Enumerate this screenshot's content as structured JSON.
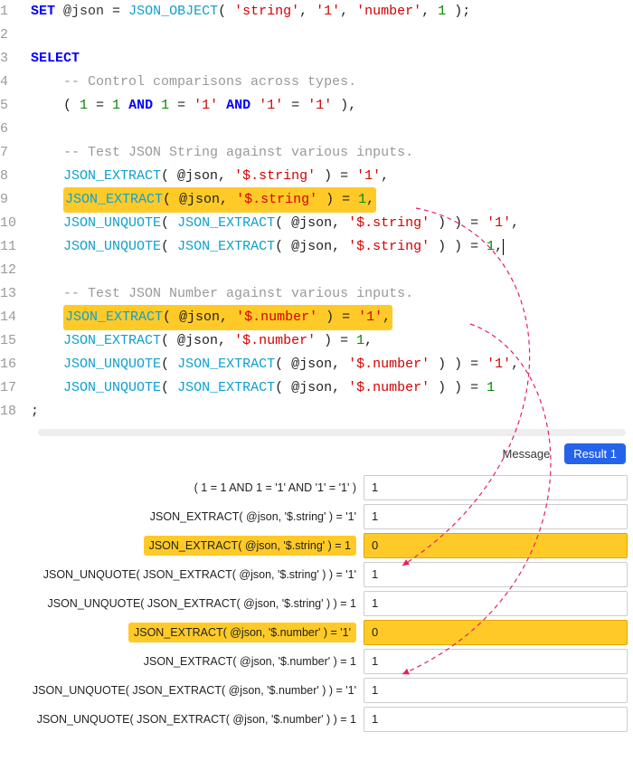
{
  "editor": {
    "lines": [
      {
        "n": 1,
        "tokens": [
          {
            "t": "SET",
            "c": "kw"
          },
          {
            "t": " ",
            "c": "txt"
          },
          {
            "t": "@json",
            "c": "var"
          },
          {
            "t": " = ",
            "c": "txt"
          },
          {
            "t": "JSON_OBJECT",
            "c": "fn"
          },
          {
            "t": "( ",
            "c": "txt"
          },
          {
            "t": "'string'",
            "c": "str"
          },
          {
            "t": ", ",
            "c": "txt"
          },
          {
            "t": "'1'",
            "c": "str"
          },
          {
            "t": ", ",
            "c": "txt"
          },
          {
            "t": "'number'",
            "c": "str"
          },
          {
            "t": ", ",
            "c": "txt"
          },
          {
            "t": "1",
            "c": "num"
          },
          {
            "t": " );",
            "c": "txt"
          }
        ]
      },
      {
        "n": 2,
        "tokens": []
      },
      {
        "n": 3,
        "tokens": [
          {
            "t": "SELECT",
            "c": "kw"
          }
        ]
      },
      {
        "n": 4,
        "tokens": [
          {
            "t": "    ",
            "c": "txt"
          },
          {
            "t": "-- Control comparisons across types.",
            "c": "cmt"
          }
        ]
      },
      {
        "n": 5,
        "tokens": [
          {
            "t": "    ( ",
            "c": "txt"
          },
          {
            "t": "1",
            "c": "num"
          },
          {
            "t": " = ",
            "c": "txt"
          },
          {
            "t": "1",
            "c": "num"
          },
          {
            "t": " ",
            "c": "txt"
          },
          {
            "t": "AND",
            "c": "kw"
          },
          {
            "t": " ",
            "c": "txt"
          },
          {
            "t": "1",
            "c": "num"
          },
          {
            "t": " = ",
            "c": "txt"
          },
          {
            "t": "'1'",
            "c": "str"
          },
          {
            "t": " ",
            "c": "txt"
          },
          {
            "t": "AND",
            "c": "kw"
          },
          {
            "t": " ",
            "c": "txt"
          },
          {
            "t": "'1'",
            "c": "str"
          },
          {
            "t": " = ",
            "c": "txt"
          },
          {
            "t": "'1'",
            "c": "str"
          },
          {
            "t": " ),",
            "c": "txt"
          }
        ]
      },
      {
        "n": 6,
        "tokens": []
      },
      {
        "n": 7,
        "tokens": [
          {
            "t": "    ",
            "c": "txt"
          },
          {
            "t": "-- Test JSON String against various inputs.",
            "c": "cmt"
          }
        ]
      },
      {
        "n": 8,
        "tokens": [
          {
            "t": "    ",
            "c": "txt"
          },
          {
            "t": "JSON_EXTRACT",
            "c": "fn"
          },
          {
            "t": "( @json, ",
            "c": "txt"
          },
          {
            "t": "'$.string'",
            "c": "str"
          },
          {
            "t": " ) = ",
            "c": "txt"
          },
          {
            "t": "'1'",
            "c": "str"
          },
          {
            "t": ",",
            "c": "txt"
          }
        ]
      },
      {
        "n": 9,
        "hl": true,
        "tokens": [
          {
            "t": "JSON_EXTRACT",
            "c": "fn"
          },
          {
            "t": "( @json, ",
            "c": "txt"
          },
          {
            "t": "'$.string'",
            "c": "str"
          },
          {
            "t": " ) = ",
            "c": "txt"
          },
          {
            "t": "1",
            "c": "num"
          },
          {
            "t": ",",
            "c": "txt"
          }
        ]
      },
      {
        "n": 10,
        "tokens": [
          {
            "t": "    ",
            "c": "txt"
          },
          {
            "t": "JSON_UNQUOTE",
            "c": "fn"
          },
          {
            "t": "( ",
            "c": "txt"
          },
          {
            "t": "JSON_EXTRACT",
            "c": "fn"
          },
          {
            "t": "( @json, ",
            "c": "txt"
          },
          {
            "t": "'$.string'",
            "c": "str"
          },
          {
            "t": " ) ) = ",
            "c": "txt"
          },
          {
            "t": "'1'",
            "c": "str"
          },
          {
            "t": ",",
            "c": "txt"
          }
        ]
      },
      {
        "n": 11,
        "tokens": [
          {
            "t": "    ",
            "c": "txt"
          },
          {
            "t": "JSON_UNQUOTE",
            "c": "fn"
          },
          {
            "t": "( ",
            "c": "txt"
          },
          {
            "t": "JSON_EXTRACT",
            "c": "fn"
          },
          {
            "t": "( @json, ",
            "c": "txt"
          },
          {
            "t": "'$.string'",
            "c": "str"
          },
          {
            "t": " ) ) = ",
            "c": "txt"
          },
          {
            "t": "1",
            "c": "num"
          },
          {
            "t": ",",
            "c": "txt"
          }
        ],
        "cursor": true
      },
      {
        "n": 12,
        "tokens": []
      },
      {
        "n": 13,
        "tokens": [
          {
            "t": "    ",
            "c": "txt"
          },
          {
            "t": "-- Test JSON Number against various inputs.",
            "c": "cmt"
          }
        ]
      },
      {
        "n": 14,
        "hl": true,
        "tokens": [
          {
            "t": "JSON_EXTRACT",
            "c": "fn"
          },
          {
            "t": "( @json, ",
            "c": "txt"
          },
          {
            "t": "'$.number'",
            "c": "str"
          },
          {
            "t": " ) = ",
            "c": "txt"
          },
          {
            "t": "'1'",
            "c": "str"
          },
          {
            "t": ",",
            "c": "txt"
          }
        ]
      },
      {
        "n": 15,
        "tokens": [
          {
            "t": "    ",
            "c": "txt"
          },
          {
            "t": "JSON_EXTRACT",
            "c": "fn"
          },
          {
            "t": "( @json, ",
            "c": "txt"
          },
          {
            "t": "'$.number'",
            "c": "str"
          },
          {
            "t": " ) = ",
            "c": "txt"
          },
          {
            "t": "1",
            "c": "num"
          },
          {
            "t": ",",
            "c": "txt"
          }
        ]
      },
      {
        "n": 16,
        "tokens": [
          {
            "t": "    ",
            "c": "txt"
          },
          {
            "t": "JSON_UNQUOTE",
            "c": "fn"
          },
          {
            "t": "( ",
            "c": "txt"
          },
          {
            "t": "JSON_EXTRACT",
            "c": "fn"
          },
          {
            "t": "( @json, ",
            "c": "txt"
          },
          {
            "t": "'$.number'",
            "c": "str"
          },
          {
            "t": " ) ) = ",
            "c": "txt"
          },
          {
            "t": "'1'",
            "c": "str"
          },
          {
            "t": ",",
            "c": "txt"
          }
        ]
      },
      {
        "n": 17,
        "tokens": [
          {
            "t": "    ",
            "c": "txt"
          },
          {
            "t": "JSON_UNQUOTE",
            "c": "fn"
          },
          {
            "t": "( ",
            "c": "txt"
          },
          {
            "t": "JSON_EXTRACT",
            "c": "fn"
          },
          {
            "t": "( @json, ",
            "c": "txt"
          },
          {
            "t": "'$.number'",
            "c": "str"
          },
          {
            "t": " ) ) = ",
            "c": "txt"
          },
          {
            "t": "1",
            "c": "num"
          }
        ]
      },
      {
        "n": 18,
        "tokens": [
          {
            "t": ";",
            "c": "txt"
          }
        ]
      }
    ]
  },
  "tabs": {
    "message": "Message",
    "result1": "Result 1"
  },
  "results": [
    {
      "label": "( 1 = 1 AND 1 = '1' AND '1' = '1' )",
      "value": "1",
      "hl": false
    },
    {
      "label": "JSON_EXTRACT( @json, '$.string' ) = '1'",
      "value": "1",
      "hl": false
    },
    {
      "label": "JSON_EXTRACT( @json, '$.string' ) = 1",
      "value": "0",
      "hl": true
    },
    {
      "label": "JSON_UNQUOTE( JSON_EXTRACT( @json, '$.string' ) ) = '1'",
      "value": "1",
      "hl": false
    },
    {
      "label": "JSON_UNQUOTE( JSON_EXTRACT( @json, '$.string' ) ) = 1",
      "value": "1",
      "hl": false
    },
    {
      "label": "JSON_EXTRACT( @json, '$.number' ) = '1'",
      "value": "0",
      "hl": true
    },
    {
      "label": "JSON_EXTRACT( @json, '$.number' ) = 1",
      "value": "1",
      "hl": false
    },
    {
      "label": "JSON_UNQUOTE( JSON_EXTRACT( @json, '$.number' ) ) = '1'",
      "value": "1",
      "hl": false
    },
    {
      "label": "JSON_UNQUOTE( JSON_EXTRACT( @json, '$.number' ) ) = 1",
      "value": "1",
      "hl": false
    }
  ]
}
